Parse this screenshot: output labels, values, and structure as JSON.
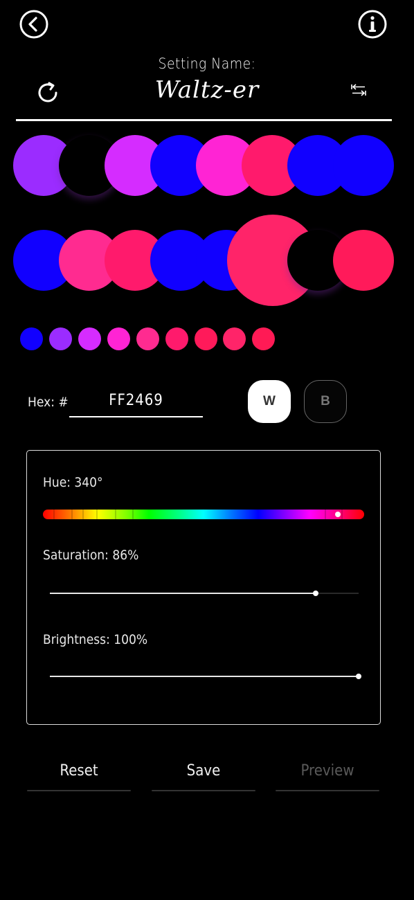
{
  "header": {
    "back_icon": "back-arrow-circle-icon",
    "info_icon": "info-circle-icon",
    "refresh_icon": "refresh-icon",
    "swap_icon": "swap-arrows-icon",
    "setting_label": "Setting Name:",
    "setting_name": "Waltz-er"
  },
  "palette": {
    "row1": [
      "#9b2cff",
      "#000000",
      "#d52cff",
      "#1100ff",
      "#ff24d4",
      "#ff1a6c",
      "#1100ff",
      "#1100ff"
    ],
    "row2": [
      "#1100ff",
      "#ff2b90",
      "#ff1a6c",
      "#1100ff",
      "#1100ff",
      "#ff2469",
      "#000000",
      "#ff1a5a"
    ],
    "chips": [
      "#1100ff",
      "#9b2cff",
      "#d52cff",
      "#ff24d4",
      "#ff2b90",
      "#ff1a6c",
      "#ff1a5a",
      "#ff2469",
      "#ff1a55"
    ]
  },
  "hex": {
    "label": "Hex: #",
    "value": "FF2469"
  },
  "mode": {
    "white_label": "W",
    "black_label": "B",
    "selected": "W"
  },
  "controls": {
    "hue_label": "Hue: 340°",
    "hue_value": 340,
    "saturation_label": "Saturation: 86%",
    "saturation_value": 86,
    "brightness_label": "Brightness: 100%",
    "brightness_value": 100
  },
  "actions": {
    "reset_label": "Reset",
    "save_label": "Save",
    "preview_label": "Preview"
  }
}
